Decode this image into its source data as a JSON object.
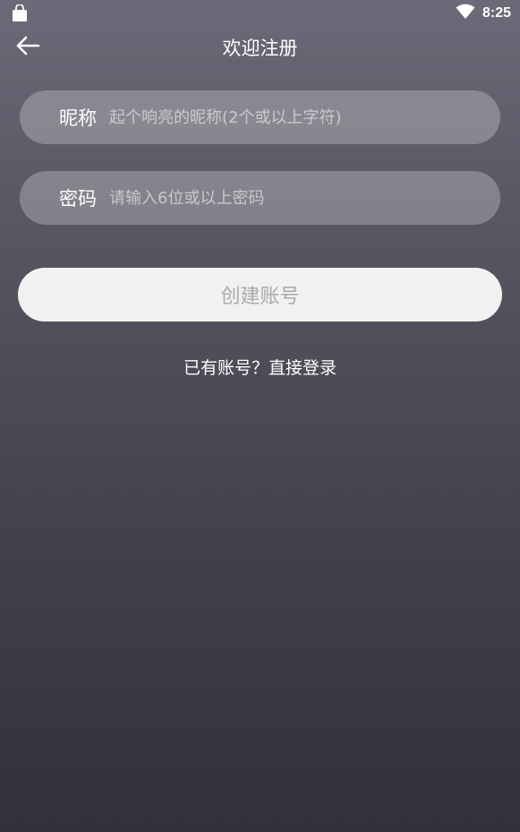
{
  "status_bar": {
    "time": "8:25",
    "icons": [
      "bag-icon",
      "wifi-icon"
    ]
  },
  "header": {
    "back_icon": "arrow-left-icon",
    "title": "欢迎注册"
  },
  "form": {
    "nickname": {
      "label": "昵称",
      "placeholder": "起个响亮的昵称(2个或以上字符)",
      "value": ""
    },
    "password": {
      "label": "密码",
      "placeholder": "请输入6位或以上密码",
      "value": ""
    },
    "submit_label": "创建账号"
  },
  "footer": {
    "login_link": "已有账号？直接登录"
  },
  "colors": {
    "background_top": "#6a6a78",
    "background_bottom": "#31313a",
    "button_bg": "#f1f1f1",
    "button_text": "#a9a9ad"
  }
}
